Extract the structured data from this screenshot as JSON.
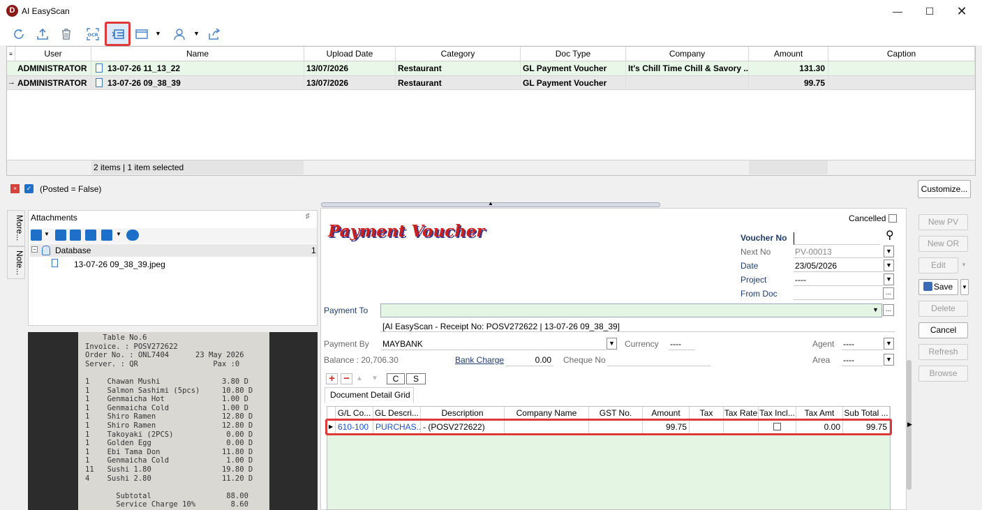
{
  "window": {
    "title": "AI EasyScan",
    "logo": "D"
  },
  "toolbar": {
    "icons": [
      "refresh-icon",
      "upload-icon",
      "delete-icon",
      "ocr-icon",
      "layout-toggle-icon",
      "window-icon",
      "user-icon",
      "share-icon"
    ],
    "ocr_label": "OCR"
  },
  "grid": {
    "columns": [
      "User",
      "Name",
      "Upload Date",
      "Category",
      "Doc Type",
      "Company",
      "Amount",
      "Caption"
    ],
    "rows": [
      {
        "user": "ADMINISTRATOR",
        "name": "13-07-26 11_13_22",
        "date": "13/07/2026",
        "category": "Restaurant",
        "doctype": "GL Payment Voucher",
        "company": "It's Chill Time Chill & Savory ...",
        "amount": "131.30",
        "caption": ""
      },
      {
        "user": "ADMINISTRATOR",
        "name": "13-07-26 09_38_39",
        "date": "13/07/2026",
        "category": "Restaurant",
        "doctype": "GL Payment Voucher",
        "company": "",
        "amount": "99.75",
        "caption": ""
      }
    ],
    "status": "2 items |  1 item selected"
  },
  "filter": {
    "text": "(Posted = False)",
    "customize": "Customize..."
  },
  "side_tabs": {
    "more": "More...",
    "notes": "Note..."
  },
  "attachments": {
    "title": "Attachments",
    "root": "Database",
    "count": "1",
    "file": "13-07-26 09_38_39.jpeg"
  },
  "receipt": {
    "lines": "    Table No.6\nInvoice. : POSV272622\nOrder No. : ONL7404      23 May 2026\nServer. : QR                 Pax :0\n\n1    Chawan Mushi              3.80 D\n1    Salmon Sashimi (5pcs)     10.80 D\n1    Genmaicha Hot             1.00 D\n1    Genmaicha Cold            1.00 D\n1    Shiro Ramen               12.80 D\n1    Shiro Ramen               12.80 D\n1    Takoyaki (2PCS)            0.00 D\n1    Golden Egg                 0.00 D\n1    Ebi Tama Don              11.80 D\n1    Genmaicha Cold             1.00 D\n11   Sushi 1.80                19.80 D\n4    Sushi 2.80                11.20 D\n\n       Subtotal                 88.00\n       Service Charge 10%        8.60"
  },
  "form": {
    "title": "Payment Voucher",
    "cancelled": "Cancelled",
    "voucher_no_label": "Voucher No",
    "voucher_no": "",
    "next_no_label": "Next No",
    "next_no": "PV-00013",
    "date_label": "Date",
    "date": "23/05/2026",
    "project_label": "Project",
    "project": "----",
    "from_doc_label": "From Doc",
    "from_doc": "",
    "payment_to_label": "Payment To",
    "payment_to": "",
    "description": "[AI EasyScan - Receipt No: POSV272622 | 13-07-26 09_38_39]",
    "payment_by_label": "Payment By",
    "payment_by": "MAYBANK",
    "currency_label": "Currency",
    "currency": "----",
    "agent_label": "Agent",
    "agent": "----",
    "balance": "Balance : 20,706.30",
    "bank_charge_label": "Bank Charge",
    "bank_charge": "0.00",
    "cheque_no_label": "Cheque No",
    "cheque_no": "",
    "area_label": "Area",
    "area": "----",
    "btn_c": "C",
    "btn_s": "S",
    "tab": "Document Detail Grid"
  },
  "detail": {
    "columns": [
      "G/L Co...",
      "GL Descri...",
      "Description",
      "Company Name",
      "GST No.",
      "Amount",
      "Tax",
      "Tax Rate",
      "Tax Incl...",
      "Tax Amt",
      "Sub Total ..."
    ],
    "row": {
      "gl_code": "610-100",
      "gl_desc": "PURCHAS...",
      "description": "-  (POSV272622)",
      "company": "",
      "gst": "",
      "amount": "99.75",
      "tax": "",
      "tax_rate": "",
      "tax_amt": "0.00",
      "subtotal": "99.75"
    }
  },
  "actions": {
    "new_pv": "New PV",
    "new_or": "New OR",
    "edit": "Edit",
    "save": "Save",
    "delete": "Delete",
    "cancel": "Cancel",
    "refresh": "Refresh",
    "browse": "Browse"
  },
  "colors": {
    "accent": "#1a5fb4",
    "highlight": "#e03838",
    "selected_row": "#e8f7e8",
    "form_title": "#cc1f1f"
  }
}
